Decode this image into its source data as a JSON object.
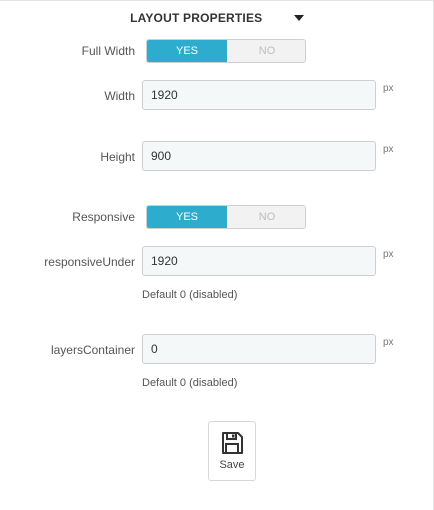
{
  "section": {
    "title": "LAYOUT PROPERTIES",
    "caret_icon": "caret-down-icon"
  },
  "fields": {
    "full_width": {
      "label": "Full Width",
      "yes_label": "YES",
      "no_label": "NO",
      "selected": "YES"
    },
    "width": {
      "label": "Width",
      "value": "1920",
      "unit": "px"
    },
    "height": {
      "label": "Height",
      "value": "900",
      "unit": "px"
    },
    "responsive": {
      "label": "Responsive",
      "yes_label": "YES",
      "no_label": "NO",
      "selected": "YES"
    },
    "responsive_under": {
      "label": "responsiveUnder",
      "value": "1920",
      "unit": "px",
      "hint": "Default 0 (disabled)"
    },
    "layers_container": {
      "label": "layersContainer",
      "value": "0",
      "unit": "px",
      "hint": "Default 0 (disabled)"
    }
  },
  "actions": {
    "save_label": "Save",
    "save_icon": "floppy-disk-icon"
  },
  "colors": {
    "toggle_active": "#2eacce",
    "toggle_inactive": "#f2f2f2",
    "input_bg": "#f5f8f9"
  }
}
